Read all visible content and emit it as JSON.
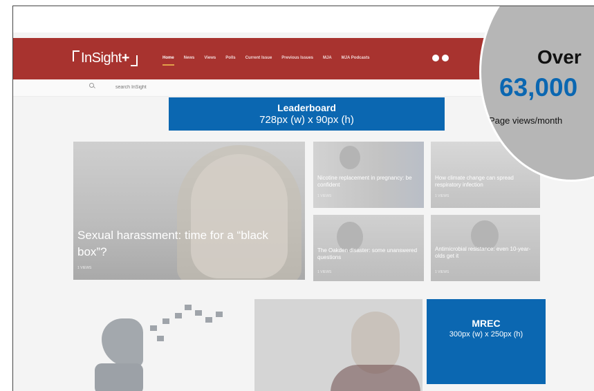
{
  "header": {
    "logo_text": "InSight",
    "logo_plus": "+",
    "nav": [
      "Home",
      "News",
      "Views",
      "Polls",
      "Current Issue",
      "Previous Issues",
      "MJA",
      "MJA Podcasts"
    ]
  },
  "search": {
    "placeholder": "search InSight"
  },
  "ads": {
    "leaderboard_title": "Leaderboard",
    "leaderboard_size": "728px (w) x 90px (h)",
    "mrec_title": "MREC",
    "mrec_size": "300px (w) x 250px (h)"
  },
  "hero": {
    "title": "Sexual harassment: time for a “black box”?",
    "views": "1 VIEWS"
  },
  "cards": [
    {
      "title": "Nicotine replacement in pregnancy: be confident",
      "views": "1 VIEWS"
    },
    {
      "title": "How climate change can spread respiratory infection",
      "views": "1 VIEWS"
    },
    {
      "title": "The Oakden disaster: some unanswered questions",
      "views": "1 VIEWS"
    },
    {
      "title": "Antimicrobial resistance: even 10-year-olds get it",
      "views": "1 VIEWS"
    }
  ],
  "stat_badge": {
    "label": "Over",
    "value": "63,000",
    "caption": "Page views/month"
  },
  "colors": {
    "nav_bg": "#a8332f",
    "ad_blue": "#0b67b1",
    "badge_gray": "#b6b6b6"
  }
}
